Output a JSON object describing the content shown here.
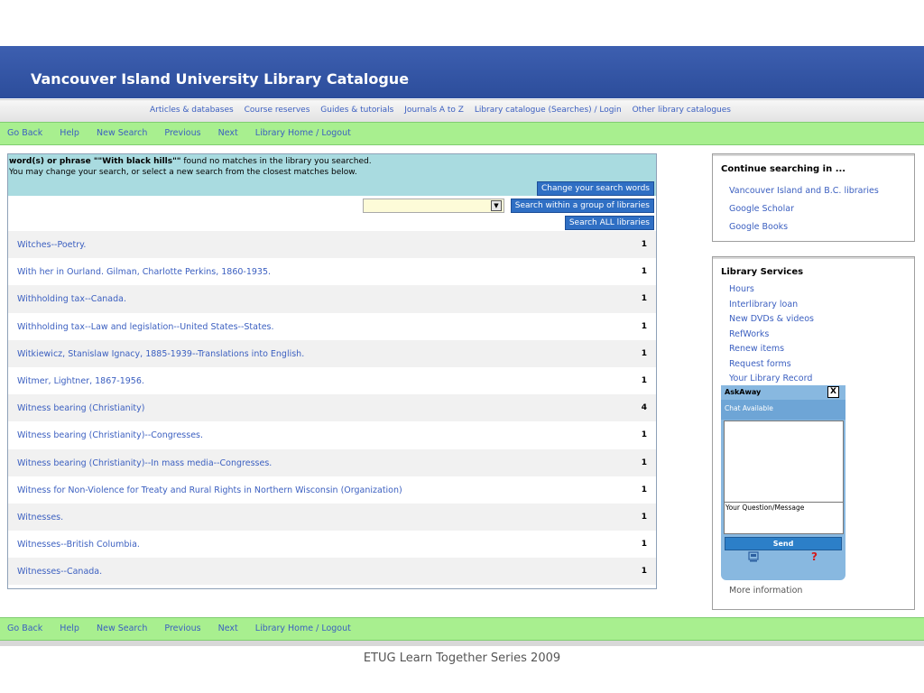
{
  "header": {
    "title": "Vancouver Island University Library Catalogue"
  },
  "topnav": {
    "items": [
      "Articles & databases",
      "Course reserves",
      "Guides & tutorials",
      "Journals A to Z",
      "Library catalogue (Searches) / Login",
      "Other library catalogues"
    ]
  },
  "nav": {
    "items": [
      "Go Back",
      "Help",
      "New Search",
      "Previous",
      "Next",
      "Library Home / Logout"
    ]
  },
  "message": {
    "prefix": "word(s) or phrase ",
    "phrase": "\"\"With black hills\"\"",
    "suffix": " found no matches in the library you searched.",
    "line2": "You may change your search, or select a new search from the closest matches below."
  },
  "buttons": {
    "change": "Change your search words",
    "group": "Search within a group of libraries",
    "all": "Search ALL libraries"
  },
  "select": {
    "arrow": "▼"
  },
  "results": [
    {
      "title": "Witches--Poetry.",
      "count": "1"
    },
    {
      "title": "With her in Ourland. Gilman, Charlotte Perkins, 1860-1935.",
      "count": "1"
    },
    {
      "title": "Withholding tax--Canada.",
      "count": "1"
    },
    {
      "title": "Withholding tax--Law and legislation--United States--States.",
      "count": "1"
    },
    {
      "title": "Witkiewicz, Stanislaw Ignacy, 1885-1939--Translations into English.",
      "count": "1"
    },
    {
      "title": "Witmer, Lightner, 1867-1956.",
      "count": "1"
    },
    {
      "title": "Witness bearing (Christianity)",
      "count": "4"
    },
    {
      "title": "Witness bearing (Christianity)--Congresses.",
      "count": "1"
    },
    {
      "title": "Witness bearing (Christianity)--In mass media--Congresses.",
      "count": "1"
    },
    {
      "title": "Witness for Non-Violence for Treaty and Rural Rights in Northern Wisconsin (Organization)",
      "count": "1"
    },
    {
      "title": "Witnesses.",
      "count": "1"
    },
    {
      "title": "Witnesses--British Columbia.",
      "count": "1"
    },
    {
      "title": "Witnesses--Canada.",
      "count": "1"
    }
  ],
  "continue": {
    "heading": "Continue searching in ...",
    "links": [
      "Vancouver Island and B.C. libraries",
      "Google Scholar",
      "Google Books"
    ]
  },
  "services": {
    "heading": "Library Services",
    "links": [
      "Hours",
      "Interlibrary loan",
      "New DVDs & videos",
      "RefWorks",
      "Renew items",
      "Request forms",
      "Your Library Record"
    ],
    "more": "More information"
  },
  "askaway": {
    "title": "AskAway",
    "close": "X",
    "status": "Chat Available",
    "question_label": "Your Question/Message",
    "send": "Send",
    "help": "?"
  },
  "footer": "ETUG Learn Together Series 2009"
}
